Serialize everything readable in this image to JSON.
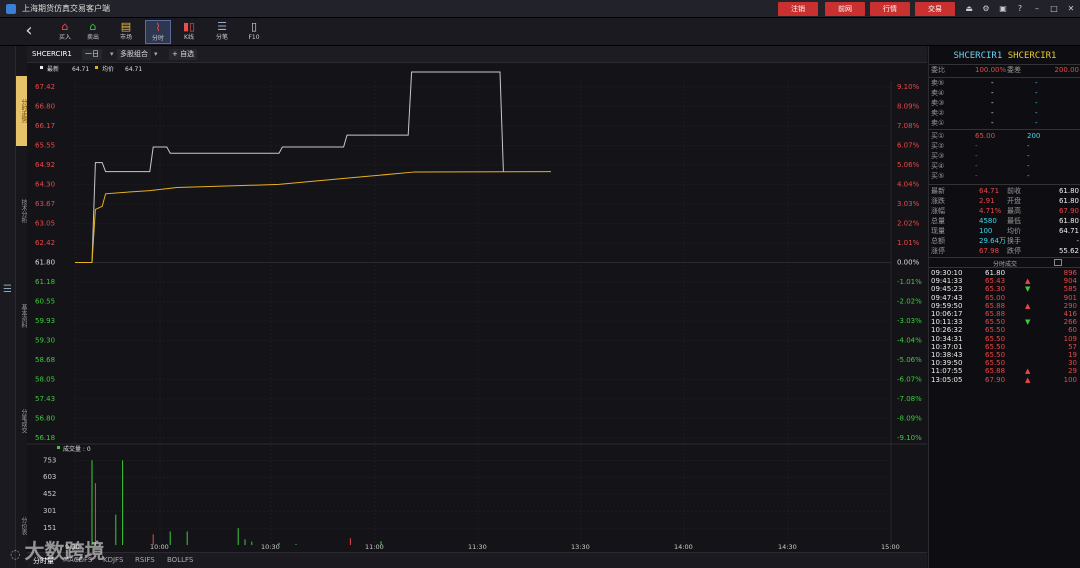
{
  "app": {
    "title": "上海期货仿真交易客户端"
  },
  "titlebar": {
    "buttons": [
      "注销",
      "前网",
      "行情",
      "交易"
    ]
  },
  "toolbar": {
    "items": [
      {
        "label": "买入",
        "icon": "buy-icon"
      },
      {
        "label": "卖出",
        "icon": "sell-icon"
      },
      {
        "label": "市场",
        "icon": "market-icon"
      },
      {
        "label": "分时",
        "icon": "timeshare-icon"
      },
      {
        "label": "K线",
        "icon": "kline-icon"
      },
      {
        "label": "分笔",
        "icon": "tick-icon"
      },
      {
        "label": "F10",
        "icon": "f10-icon"
      }
    ]
  },
  "sidetabs": [
    "分时走势",
    "技术分析",
    "基本资料",
    "分笔成交",
    "分价表"
  ],
  "chart_header": {
    "symbol": "SHCERCIR1",
    "period": "一日",
    "mode": "多股组合",
    "add": "+ 自选"
  },
  "legend": {
    "latest_label": "最新",
    "latest_value": "64.71",
    "avg_label": "均价",
    "avg_value": "64.71"
  },
  "volume_header": "成交量 : 0",
  "bottom_tabs": [
    "分时量",
    "MACDFS",
    "KDJFS",
    "RSIFS",
    "BOLLFS"
  ],
  "chart_data": {
    "type": "line",
    "price_ticks_left": [
      "67.42",
      "66.80",
      "66.17",
      "65.55",
      "64.92",
      "64.30",
      "63.67",
      "63.05",
      "62.42",
      "61.80",
      "61.18",
      "60.55",
      "59.93",
      "59.30",
      "58.68",
      "58.05",
      "57.43",
      "56.80",
      "56.18"
    ],
    "pct_ticks_right": [
      "9.10%",
      "8.09%",
      "7.08%",
      "6.07%",
      "5.06%",
      "4.04%",
      "3.03%",
      "2.02%",
      "1.01%",
      "0.00%",
      "-1.01%",
      "-2.02%",
      "-3.03%",
      "-4.04%",
      "-5.06%",
      "-6.07%",
      "-7.08%",
      "-8.09%",
      "-9.10%"
    ],
    "x_ticks": [
      "9:30",
      "10:00",
      "10:30",
      "11:00",
      "11:30",
      "13:30",
      "14:00",
      "14:30",
      "15:00"
    ],
    "volume_ticks": [
      "753",
      "603",
      "452",
      "301",
      "151"
    ],
    "ylim": [
      56.18,
      67.42
    ],
    "series": [
      {
        "name": "最新",
        "color": "#c8c8c8",
        "points": [
          [
            0,
            61.8
          ],
          [
            5,
            61.8
          ],
          [
            6,
            65.0
          ],
          [
            8,
            65.0
          ],
          [
            9,
            64.71
          ],
          [
            22,
            64.71
          ],
          [
            23,
            65.5
          ],
          [
            27,
            65.5
          ],
          [
            28,
            65.3
          ],
          [
            60,
            65.3
          ],
          [
            61,
            65.5
          ],
          [
            79,
            65.5
          ],
          [
            80,
            65.88
          ],
          [
            98,
            65.88
          ],
          [
            99,
            67.9
          ],
          [
            125,
            67.9
          ],
          [
            126,
            64.71
          ]
        ]
      },
      {
        "name": "均价",
        "color": "#e8b020",
        "points": [
          [
            0,
            61.8
          ],
          [
            5,
            61.8
          ],
          [
            6,
            63.5
          ],
          [
            8,
            63.6
          ],
          [
            9,
            64.0
          ],
          [
            15,
            64.05
          ],
          [
            22,
            64.1
          ],
          [
            30,
            64.2
          ],
          [
            60,
            64.3
          ],
          [
            80,
            64.5
          ],
          [
            100,
            64.7
          ],
          [
            140,
            64.71
          ]
        ]
      }
    ],
    "volumes": [
      [
        5,
        753
      ],
      [
        6,
        550
      ],
      [
        12,
        270
      ],
      [
        14,
        753
      ],
      [
        23,
        95
      ],
      [
        28,
        120
      ],
      [
        33,
        120
      ],
      [
        48,
        150
      ],
      [
        50,
        50
      ],
      [
        52,
        30
      ],
      [
        60,
        20
      ],
      [
        65,
        10
      ],
      [
        81,
        60
      ],
      [
        90,
        35
      ]
    ],
    "volume_colors": [
      "#3acc3a",
      "#e84848",
      "#3acc3a",
      "#3acc3a",
      "#e84848",
      "#3acc3a",
      "#3acc3a",
      "#3acc3a",
      "#3acc3a",
      "#3acc3a",
      "#3acc3a",
      "#3acc3a",
      "#e84848",
      "#3acc3a"
    ]
  },
  "quote": {
    "symbol_a": "SHCERCIR1",
    "symbol_b": "SHCERCIR1",
    "ratio_label": "委比",
    "ratio_value": "100.00%",
    "diff_label": "委差",
    "diff_value": "200.00",
    "asks": [
      {
        "label": "卖⑤",
        "price": "-",
        "vol": "-"
      },
      {
        "label": "卖④",
        "price": "-",
        "vol": "-"
      },
      {
        "label": "卖③",
        "price": "-",
        "vol": "-"
      },
      {
        "label": "卖②",
        "price": "-",
        "vol": "-"
      },
      {
        "label": "卖①",
        "price": "-",
        "vol": "-"
      }
    ],
    "bids": [
      {
        "label": "买①",
        "price": "65.00",
        "vol": "200"
      },
      {
        "label": "买②",
        "price": "-",
        "vol": "-"
      },
      {
        "label": "买③",
        "price": "-",
        "vol": "-"
      },
      {
        "label": "买④",
        "price": "-",
        "vol": "-"
      },
      {
        "label": "买⑤",
        "price": "-",
        "vol": "-"
      }
    ],
    "stats": [
      {
        "l1": "最新",
        "v1": "64.71",
        "l2": "前收",
        "v2": "61.80"
      },
      {
        "l1": "涨跌",
        "v1": "2.91",
        "l2": "开盘",
        "v2": "61.80"
      },
      {
        "l1": "涨幅",
        "v1": "4.71%",
        "l2": "最高",
        "v2": "67.90"
      },
      {
        "l1": "总量",
        "v1": "4580",
        "l2": "最低",
        "v2": "61.80"
      },
      {
        "l1": "现量",
        "v1": "100",
        "l2": "均价",
        "v2": "64.71"
      },
      {
        "l1": "总额",
        "v1": "29.64万",
        "l2": "换手",
        "v2": "-"
      },
      {
        "l1": "涨停",
        "v1": "67.98",
        "l2": "跌停",
        "v2": "55.62"
      }
    ],
    "trades_title": "分时成交",
    "trades": [
      {
        "time": "09:30:10",
        "price": "61.80",
        "dir": "",
        "vol": "896"
      },
      {
        "time": "09:41:33",
        "price": "65.43",
        "dir": "▲",
        "vol": "904"
      },
      {
        "time": "09:45:23",
        "price": "65.30",
        "dir": "▼",
        "vol": "585"
      },
      {
        "time": "09:47:43",
        "price": "65.00",
        "dir": "",
        "vol": "901"
      },
      {
        "time": "09:59:50",
        "price": "65.88",
        "dir": "▲",
        "vol": "290"
      },
      {
        "time": "10:06:17",
        "price": "65.88",
        "dir": "",
        "vol": "416"
      },
      {
        "time": "10:11:33",
        "price": "65.50",
        "dir": "▼",
        "vol": "266"
      },
      {
        "time": "10:26:32",
        "price": "65.50",
        "dir": "",
        "vol": "60"
      },
      {
        "time": "10:34:31",
        "price": "65.50",
        "dir": "",
        "vol": "109"
      },
      {
        "time": "10:37:01",
        "price": "65.50",
        "dir": "",
        "vol": "57"
      },
      {
        "time": "10:38:43",
        "price": "65.50",
        "dir": "",
        "vol": "19"
      },
      {
        "time": "10:39:50",
        "price": "65.50",
        "dir": "",
        "vol": "30"
      },
      {
        "time": "11:07:55",
        "price": "65.88",
        "dir": "▲",
        "vol": "29"
      },
      {
        "time": "13:05:05",
        "price": "67.90",
        "dir": "▲",
        "vol": "100"
      }
    ]
  },
  "watermark": "大数跨境"
}
